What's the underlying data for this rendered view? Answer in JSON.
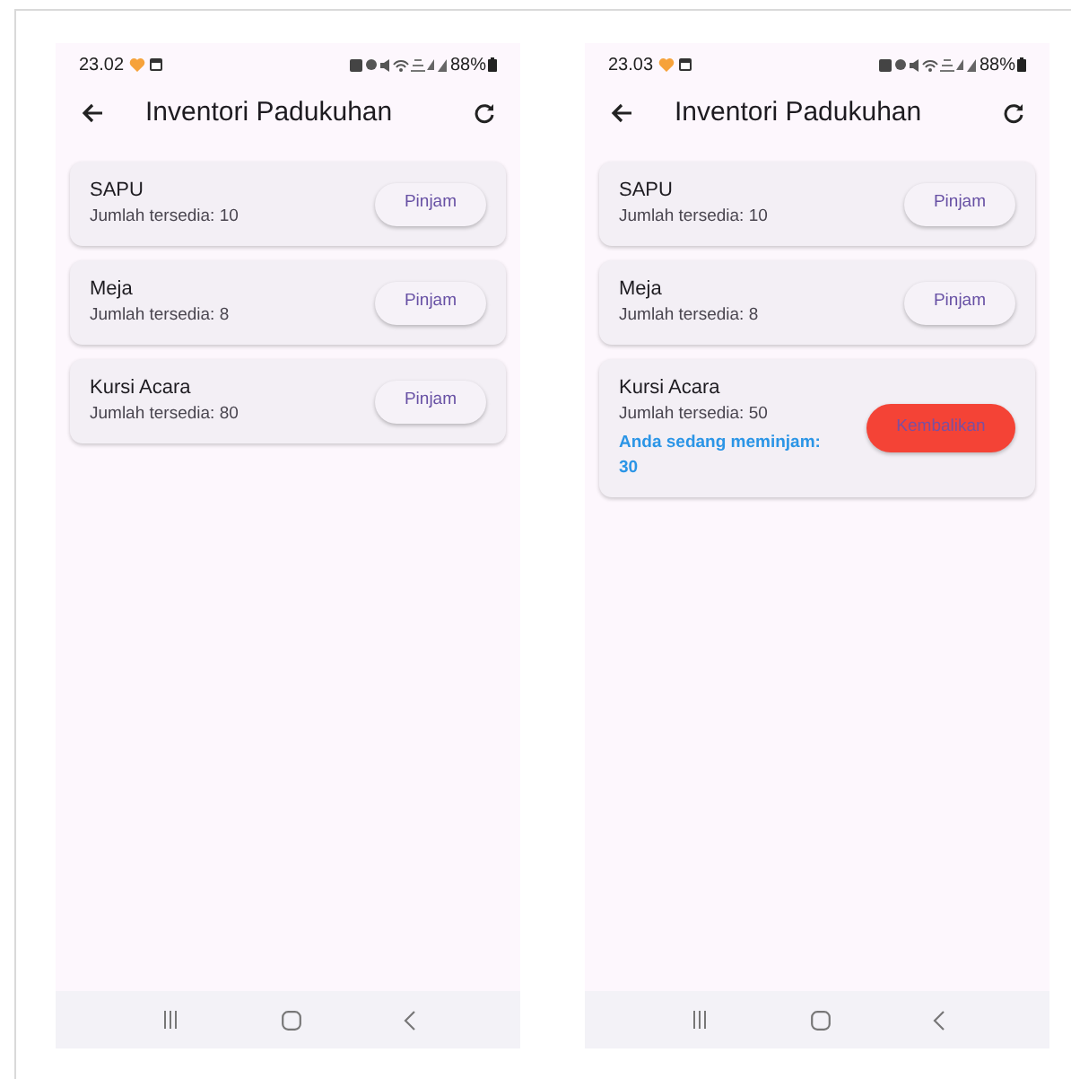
{
  "screens": [
    {
      "status_bar": {
        "time": "23.02",
        "battery": "88%"
      },
      "app_bar": {
        "title": "Inventori Padukuhan"
      },
      "items": [
        {
          "name": "SAPU",
          "stock": "Jumlah tersedia: 10",
          "button": {
            "kind": "borrow",
            "label": "Pinjam"
          }
        },
        {
          "name": "Meja",
          "stock": "Jumlah tersedia: 8",
          "button": {
            "kind": "borrow",
            "label": "Pinjam"
          }
        },
        {
          "name": "Kursi Acara",
          "stock": "Jumlah tersedia: 80",
          "button": {
            "kind": "borrow",
            "label": "Pinjam"
          }
        }
      ]
    },
    {
      "status_bar": {
        "time": "23.03",
        "battery": "88%"
      },
      "app_bar": {
        "title": "Inventori Padukuhan"
      },
      "items": [
        {
          "name": "SAPU",
          "stock": "Jumlah tersedia: 10",
          "button": {
            "kind": "borrow",
            "label": "Pinjam"
          }
        },
        {
          "name": "Meja",
          "stock": "Jumlah tersedia: 8",
          "button": {
            "kind": "borrow",
            "label": "Pinjam"
          }
        },
        {
          "name": "Kursi Acara",
          "stock": "Jumlah tersedia: 50",
          "note": "Anda sedang meminjam: 30",
          "button": {
            "kind": "return",
            "label": "Kembalikan"
          }
        }
      ]
    }
  ]
}
